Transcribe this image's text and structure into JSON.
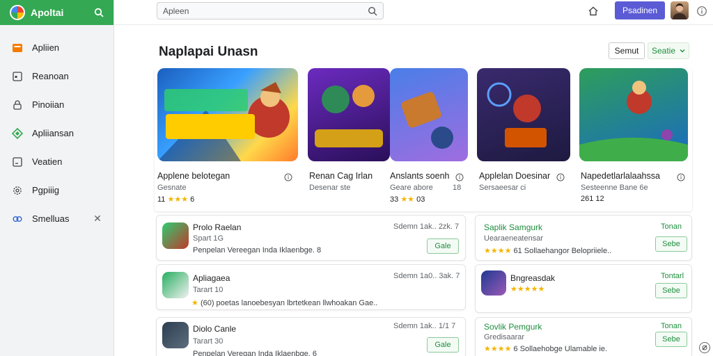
{
  "app": {
    "name": "Apoltai"
  },
  "sidebar": {
    "items": [
      {
        "label": "Apliien",
        "icon": "apps-icon"
      },
      {
        "label": "Reanoan",
        "icon": "window-icon"
      },
      {
        "label": "Pinoiian",
        "icon": "lock-icon"
      },
      {
        "label": "Apliiansan",
        "icon": "diamond-icon"
      },
      {
        "label": "Veatien",
        "icon": "frame-icon"
      },
      {
        "label": "Pgpiiig",
        "icon": "gear-icon"
      },
      {
        "label": "Smelluas",
        "icon": "link-icon"
      }
    ],
    "close_symbol": "✕"
  },
  "topbar": {
    "search_placeholder": "Apleen",
    "primary_button": "Psadinen"
  },
  "section": {
    "title": "Naplapai Unasn",
    "secondary_button": "Semut",
    "see_all": "Seatie"
  },
  "featured": [
    {
      "title": "Applene belotegan",
      "subtitle": "Gesnate",
      "rating_num": "11",
      "stars": "★★★",
      "rating_end": "6"
    },
    {
      "title": "Renan Cag Irlan",
      "subtitle": "Desenar ste",
      "rating_num": "",
      "stars": "",
      "rating_end": ""
    },
    {
      "title": "Anslants soenh",
      "subtitle": "Geare abore",
      "rating_num": "33",
      "stars": "★★",
      "rating_end": "03",
      "extra": "18"
    },
    {
      "title": "Applelan Doesinar",
      "subtitle": "Sersaeesar ci",
      "rating_num": "",
      "stars": "",
      "rating_end": ""
    },
    {
      "title": "Napedetlarlalaahssa",
      "subtitle": "Sesteenne Bane 6e",
      "rating_num": "261",
      "stars": "",
      "rating_end": "12"
    }
  ],
  "list_left": [
    {
      "title": "Prolo Raelan",
      "sub": "Spart 1G",
      "meta": "Sdemn 1ak.. 2zk. 7",
      "desc": "Penpelan Vereegan Inda Iklaenbge. 8",
      "button": "Gale"
    },
    {
      "title": "Apliagaea",
      "sub": "Tarart 10",
      "meta": "Sdemn 1a0.. 3ak. 7",
      "desc": "(60) poetas lanoebesyan lbrtetkean llwhoakan Gae..",
      "button": ""
    },
    {
      "title": "Diolo Canle",
      "sub": "Tarart 30",
      "meta": "Sdemn 1ak.. 1/1 7",
      "desc": "Penpelan Veregan Inda Iklaenbge. 6",
      "button": "Gale"
    }
  ],
  "list_right": [
    {
      "title": "Saplik Samgurk",
      "sub": "Uearaeneatensar",
      "desc": "61 Sollaehangor Belopriiele..",
      "tag": "Tonan",
      "button": "Sebe"
    },
    {
      "title": "Bngreasdak",
      "sub": "",
      "desc": "",
      "tag": "Tontarl",
      "button": "Sebe"
    },
    {
      "title": "Sovlik Pemgurk",
      "sub": "Gredisaarar",
      "desc": "6 Sollaehobge Ulamable ie.",
      "tag": "Tonan",
      "button": "Sebe"
    }
  ],
  "colors": {
    "brand": "#34a853",
    "primary": "#5b5bd6",
    "star": "#f4b400"
  }
}
